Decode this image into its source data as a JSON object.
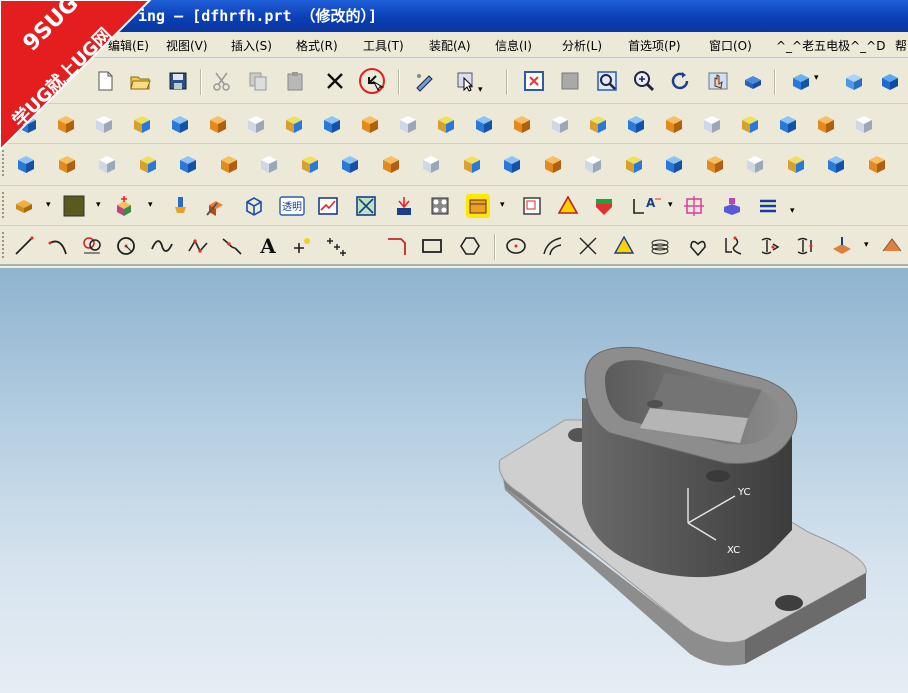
{
  "window": {
    "title": "ing – [dfhrfh.prt （修改的）]"
  },
  "menu": [
    {
      "label": "编辑(E)"
    },
    {
      "label": "视图(V)"
    },
    {
      "label": "插入(S)"
    },
    {
      "label": "格式(R)"
    },
    {
      "label": "工具(T)"
    },
    {
      "label": "装配(A)"
    },
    {
      "label": "信息(I)"
    },
    {
      "label": "分析(L)"
    },
    {
      "label": "首选项(P)"
    },
    {
      "label": "窗口(O)"
    },
    {
      "label": "^_^老五电极^_^D"
    },
    {
      "label": "帮"
    }
  ],
  "toolbar4": {
    "transparency_label": "透明"
  },
  "toolbar5": {
    "text_tool_label": "A"
  },
  "view_triad": {
    "y_label": "YC",
    "x_label": "XC"
  },
  "watermark": {
    "line1": "9SUG",
    "line2": "学UG就上UG网"
  },
  "colors": {
    "titlebar": "#0b3fb6",
    "toolbar_bg": "#ece9d8",
    "viewport_top": "#8fb3cf",
    "viewport_bottom": "#e6edf4",
    "part_gray": "#8a8a8a",
    "watermark_red": "#e41e1e",
    "icon_blue": "#2a78d8",
    "icon_orange": "#f0a020"
  },
  "icons": {
    "toolbar1": [
      "new-file",
      "open-folder",
      "save",
      "cut",
      "copy",
      "paste",
      "delete",
      "undo",
      "edit-sketch",
      "select-filter",
      "fit-view",
      "zoom-window",
      "zoom-region",
      "zoom-in-out",
      "rotate",
      "pan",
      "hide-show",
      "view-orientation",
      "isometric-view",
      "shaded-view"
    ],
    "toolbar2": [
      "block",
      "cylinder",
      "cone",
      "sphere",
      "extrude",
      "revolve",
      "hole",
      "boss",
      "pocket",
      "pad",
      "slot",
      "groove",
      "edge-blend",
      "chamfer",
      "shell",
      "draft",
      "thread",
      "trim-body",
      "split-body",
      "pattern",
      "mirror",
      "offset-face",
      "scale"
    ],
    "toolbar3": [
      "unite",
      "subtract",
      "intersect",
      "sew",
      "patch",
      "extract",
      "sweep",
      "tube",
      "rib",
      "emboss",
      "offset-surface",
      "thicken",
      "bounded-plane",
      "through-curves",
      "through-mesh",
      "swept-surface",
      "n-sided",
      "face-blend",
      "datum-plane",
      "datum-axis",
      "datum-csys",
      "point"
    ],
    "toolbar4": [
      "layer-settings",
      "color",
      "move-object",
      "blank",
      "edit-object-display",
      "wireframe",
      "transparency",
      "section-view",
      "clip",
      "measure-distance",
      "measure-angle",
      "check-geometry",
      "highlight",
      "drafting",
      "warning",
      "shaded-faces",
      "annotation",
      "origin",
      "analysis",
      "properties"
    ],
    "toolbar5": [
      "line",
      "arc",
      "circle-3pt",
      "circle",
      "spline",
      "studio-spline",
      "bridge-curve",
      "text",
      "point",
      "point-set",
      "rectangle-corner",
      "rectangle",
      "polygon",
      "ellipse",
      "offset-curve",
      "intersection-curve",
      "project-curve",
      "helix",
      "law-curve",
      "combined-curve",
      "isoparametric",
      "extract-curve",
      "wrap-curve",
      "divide-curve"
    ]
  }
}
